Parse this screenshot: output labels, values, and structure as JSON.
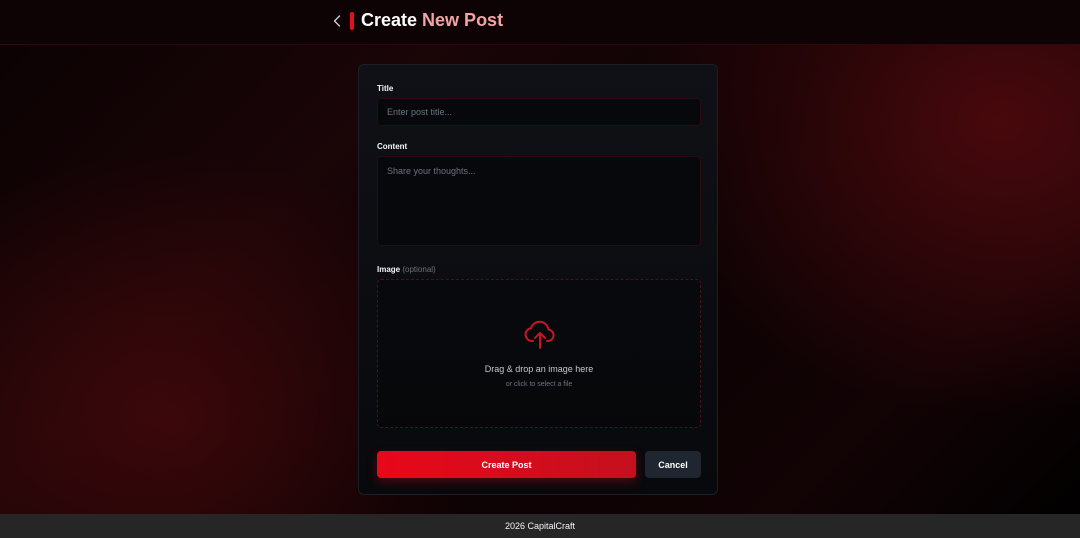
{
  "header": {
    "back_icon": "chevron-left-icon",
    "title_prefix": "Create",
    "title_suffix": "New Post"
  },
  "form": {
    "title_label": "Title",
    "title_placeholder": "Enter post title...",
    "title_value": "",
    "content_label": "Content",
    "content_placeholder": "Share your thoughts...",
    "content_value": "",
    "image_label": "Image",
    "image_optional": "(optional)",
    "dropzone": {
      "icon": "cloud-upload-icon",
      "main_text": "Drag & drop an image here",
      "sub_text": "or click to select a file"
    },
    "submit_label": "Create Post",
    "cancel_label": "Cancel"
  },
  "footer": {
    "text": "2026 CapitalCraft"
  },
  "colors": {
    "accent": "#e3101e",
    "title_accent_text": "#f3a3a3",
    "button_primary": "#e8081a",
    "button_secondary": "#1f2630",
    "footer_bg": "#262626"
  }
}
